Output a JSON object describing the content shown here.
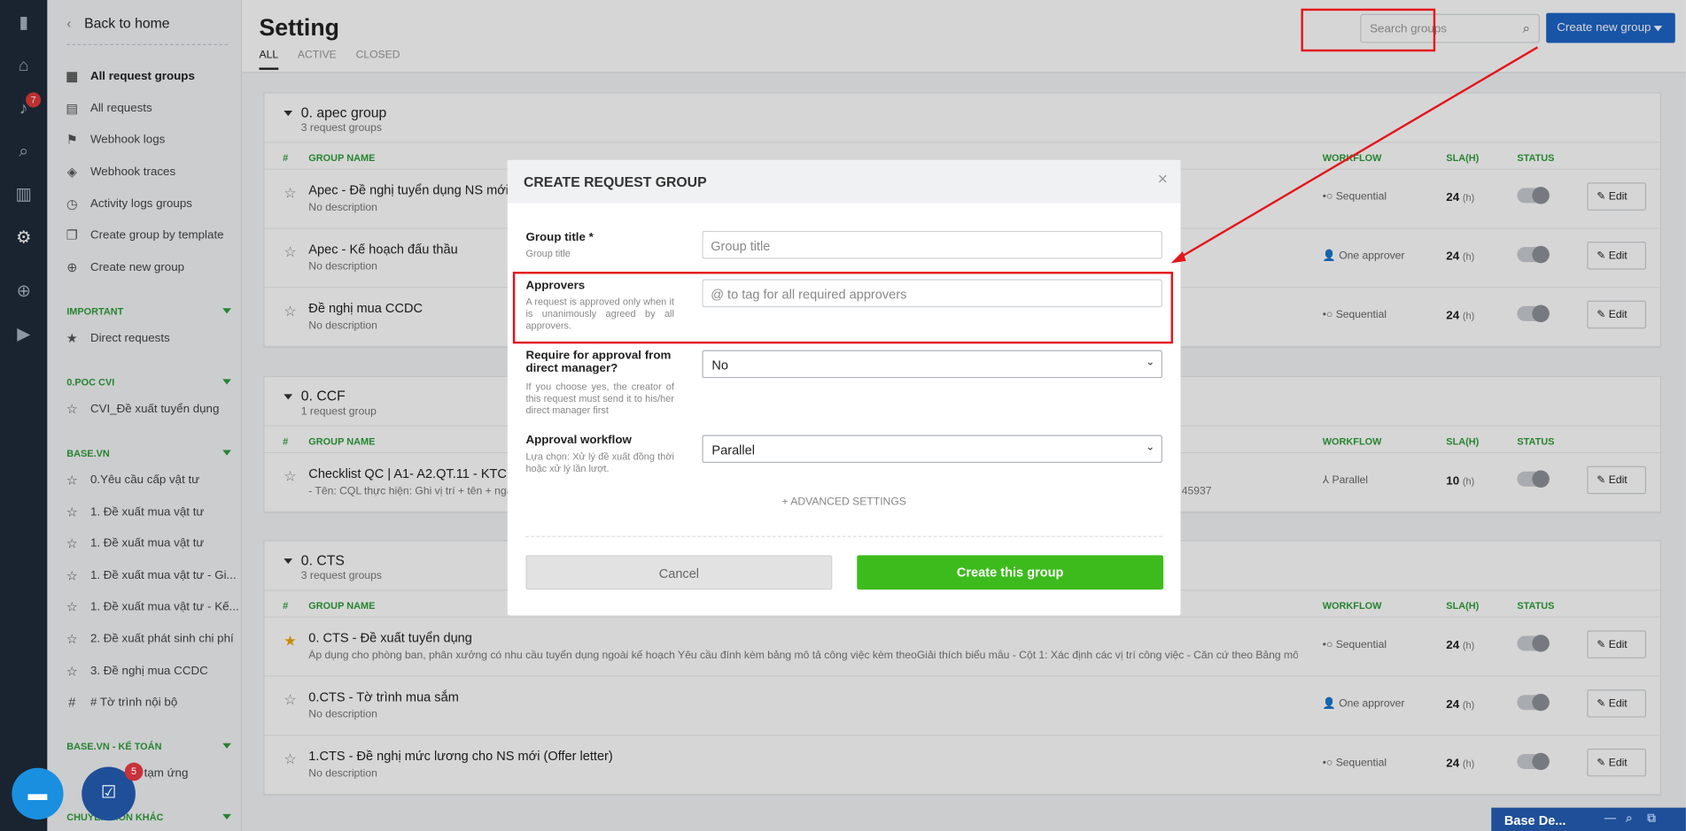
{
  "sidebar": {
    "back_label": "Back to home",
    "items": [
      {
        "label": "All request groups",
        "icon": "grid-icon",
        "bold": true
      },
      {
        "label": "All requests",
        "icon": "document-icon"
      },
      {
        "label": "Webhook logs",
        "icon": "flag-icon"
      },
      {
        "label": "Webhook traces",
        "icon": "layers-icon"
      },
      {
        "label": "Activity logs groups",
        "icon": "clock-icon"
      },
      {
        "label": "Create group by template",
        "icon": "template-icon"
      },
      {
        "label": "Create new group",
        "icon": "plus-circle-icon"
      }
    ],
    "sections": [
      {
        "title": "IMPORTANT",
        "items": [
          {
            "label": "Direct requests",
            "icon": "star-filled-icon"
          }
        ]
      },
      {
        "title": "0.POC CVI",
        "items": [
          {
            "label": "CVI_Đề xuất tuyển dụng",
            "icon": "star-icon"
          }
        ]
      },
      {
        "title": "BASE.VN",
        "items": [
          {
            "label": "0.Yêu cầu cấp vật tư",
            "icon": "star-icon"
          },
          {
            "label": "1. Đề xuất mua vật tư",
            "icon": "star-icon"
          },
          {
            "label": "1. Đề xuất mua vật tư",
            "icon": "star-icon"
          },
          {
            "label": "1. Đề xuất mua vật tư - Gi...",
            "icon": "star-icon"
          },
          {
            "label": "1. Đề xuất mua vật tư - Kế...",
            "icon": "star-icon"
          },
          {
            "label": "2. Đề xuất phát sinh chi phí",
            "icon": "star-icon"
          },
          {
            "label": "3. Đề nghị mua CCDC",
            "icon": "star-icon"
          },
          {
            "label": "# Tờ trình nội bộ",
            "icon": "hash-icon"
          }
        ]
      },
      {
        "title": "BASE.VN - KẾ TOÁN",
        "items": [
          {
            "label": "tạm ứng",
            "icon": "star-icon"
          }
        ]
      },
      {
        "title": "CHUYÊN MÔN KHÁC",
        "items": []
      }
    ]
  },
  "rail": {
    "notification_count": "7"
  },
  "header": {
    "title": "Setting",
    "tabs": [
      "ALL",
      "ACTIVE",
      "CLOSED"
    ],
    "search_placeholder": "Search groups",
    "create_button": "Create new group"
  },
  "table_headers": {
    "num": "#",
    "name": "GROUP NAME",
    "workflow": "WORKFLOW",
    "sla": "SLA(H)",
    "status": "STATUS"
  },
  "edit_label": "Edit",
  "sla_unit": "(h)",
  "groups": [
    {
      "title": "0. apec group",
      "count": "3 request groups",
      "rows": [
        {
          "name": "Apec - Đề nghị tuyển dụng NS mới",
          "desc": "No description",
          "workflow": "Sequential",
          "sla": "24"
        },
        {
          "name": "Apec - Kế hoạch đấu thầu",
          "desc": "No description",
          "workflow": "One approver",
          "sla": "24"
        },
        {
          "name": "Đề nghị mua CCDC",
          "desc": "No description",
          "workflow": "Sequential",
          "sla": "24"
        }
      ]
    },
    {
      "title": "0. CCF",
      "count": "1 request group",
      "rows": [
        {
          "name": "Checklist QC | A1- A2.QT.11 - KTCL",
          "desc": "- Tên: CQL thực hiện: Ghi vị trí + tên + ngày",
          "desc_tail": "45937",
          "workflow": "Parallel",
          "sla": "10"
        }
      ]
    },
    {
      "title": "0. CTS",
      "count": "3 request groups",
      "rows": [
        {
          "name": "0. CTS - Đề xuất tuyển dụng",
          "desc": "Áp dụng cho phòng ban, phân xưởng có nhu cầu tuyển dụng ngoài kế hoạch Yêu cầu đính kèm bảng mô tả công việc kèm theoGiải thích biểu mẫu - Cột 1: Xác định các vị trí công việc - Căn cứ theo Bảng mô tả ...",
          "workflow": "Sequential",
          "sla": "24",
          "starred": true
        },
        {
          "name": "0.CTS - Tờ trình mua sắm",
          "desc": "No description",
          "workflow": "One approver",
          "sla": "24"
        },
        {
          "name": "1.CTS - Đề nghị mức lương cho NS mới (Offer letter)",
          "desc": "No description",
          "workflow": "Sequential",
          "sla": "24"
        }
      ]
    }
  ],
  "modal": {
    "title": "CREATE REQUEST GROUP",
    "close": "×",
    "fields": {
      "group_title": {
        "label": "Group title *",
        "help": "Group title",
        "placeholder": "Group title"
      },
      "approvers": {
        "label": "Approvers",
        "help": "A request is approved only when it is unanimously agreed by all approvers.",
        "placeholder": "@ to tag for all required approvers"
      },
      "manager": {
        "label": "Require for approval from direct manager?",
        "help": "If you choose yes, the creator of this request must send it to his/her direct manager first",
        "value": "No"
      },
      "workflow": {
        "label": "Approval workflow",
        "help": "Lựa chọn: Xử lý đề xuất đồng thời hoặc xử lý lần lượt.",
        "value": "Parallel"
      }
    },
    "advanced": "+ ADVANCED SETTINGS",
    "cancel": "Cancel",
    "create": "Create this group"
  },
  "widgets": {
    "chat_badge": "5",
    "dock_title": "Base De..."
  },
  "colors": {
    "accent": "#1e66c7",
    "success": "#3dbb1c",
    "highlight": "#e4141b",
    "section": "#2e9e3a"
  }
}
